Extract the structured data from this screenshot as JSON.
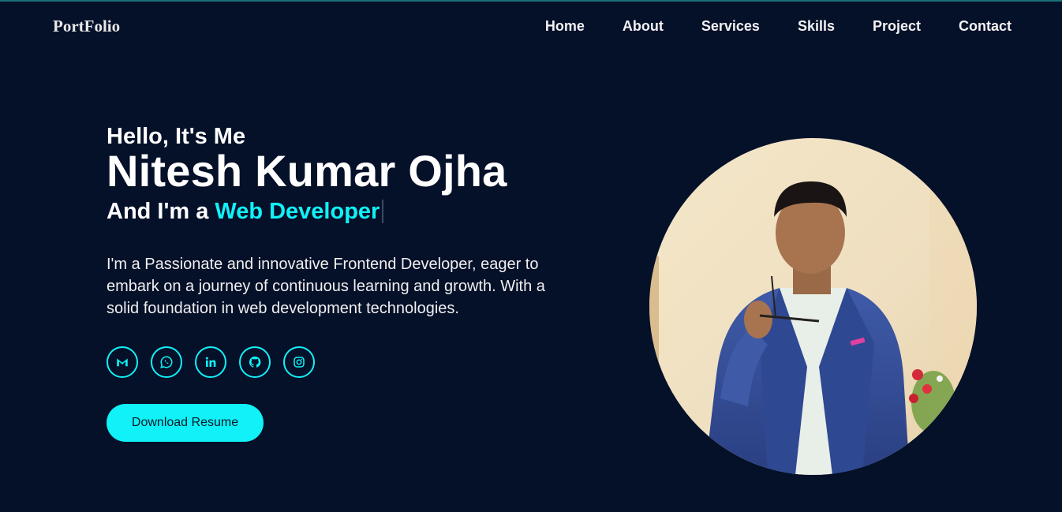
{
  "header": {
    "logo": "PortFolio",
    "nav": [
      "Home",
      "About",
      "Services",
      "Skills",
      "Project",
      "Contact"
    ]
  },
  "hero": {
    "greeting": "Hello, It's Me",
    "name": "Nitesh Kumar Ojha",
    "role_prefix": "And I'm a",
    "role_highlight": "Web Developer",
    "description": "I'm a Passionate and innovative Frontend Developer, eager to embark on a journey of continuous learning and growth. With a solid foundation in web development technologies.",
    "socials": [
      "gmail-icon",
      "whatsapp-icon",
      "linkedin-icon",
      "github-icon",
      "instagram-icon"
    ],
    "download_label": "Download Resume"
  },
  "colors": {
    "background": "#051029",
    "accent": "#10f2f7",
    "text": "#ffffff"
  }
}
